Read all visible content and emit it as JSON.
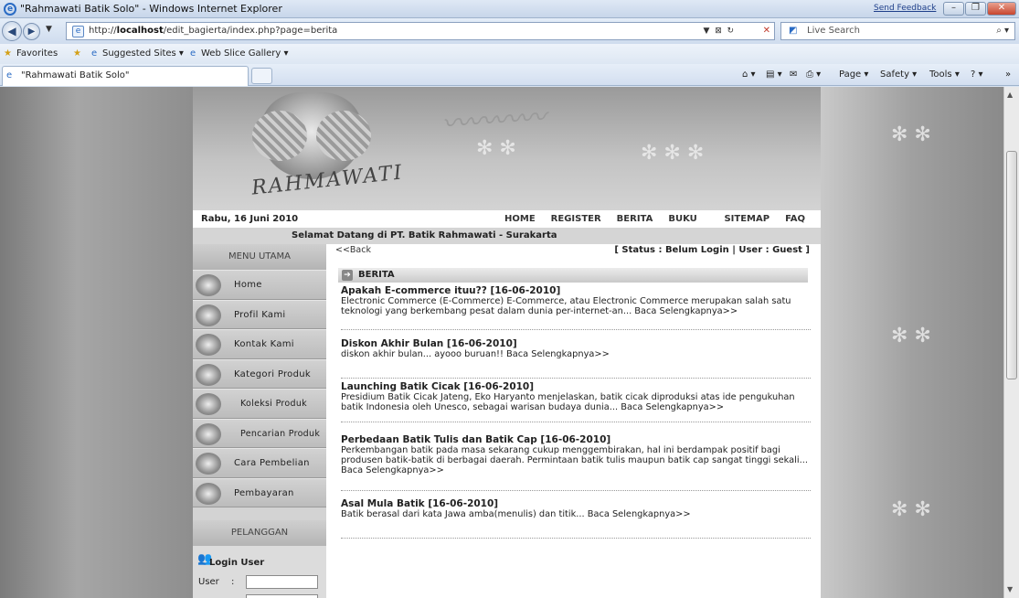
{
  "window": {
    "title": "\"Rahmawati Batik Solo\" - Windows Internet Explorer",
    "feedback": "Send Feedback"
  },
  "nav": {
    "url_prefix": "http://",
    "url_host": "localhost",
    "url_path": "/edit_bagierta/index.php?page=berita",
    "search_placeholder": "Live Search"
  },
  "favorites": {
    "favorites_label": "Favorites",
    "suggested_sites": "Suggested Sites ▾",
    "web_slice": "Web Slice Gallery ▾"
  },
  "tab": {
    "title": "\"Rahmawati Batik Solo\""
  },
  "command_bar": {
    "page": "Page ▾",
    "safety": "Safety ▾",
    "tools": "Tools ▾"
  },
  "site": {
    "brand": "RAHMAWATI",
    "date": "Rabu, 16 Juni 2010",
    "top_menu": [
      "HOME",
      "REGISTER",
      "BERITA",
      "BUKU TAMU",
      "SITEMAP",
      "FAQ"
    ],
    "welcome": "Selamat Datang di PT. Batik Rahmawati - Surakarta"
  },
  "sidebar": {
    "menu_title": "MENU UTAMA",
    "items": [
      {
        "label": "Home"
      },
      {
        "label": "Profil Kami"
      },
      {
        "label": "Kontak Kami"
      },
      {
        "label": "Kategori Produk"
      },
      {
        "label": "Koleksi Produk"
      },
      {
        "label": "Pencarian Produk"
      },
      {
        "label": "Cara Pembelian"
      },
      {
        "label": "Pembayaran"
      }
    ],
    "customer_title": "PELANGGAN",
    "login_title": "Login User",
    "user_label": "User",
    "colon": ":"
  },
  "content": {
    "back": "<<Back",
    "status": "[ Status : Belum Login | User : Guest ]",
    "section_title": "BERITA",
    "news": [
      {
        "title": "Apakah E-commerce ituu?? [16-06-2010]",
        "body": "Electronic Commerce (E-Commerce) E-Commerce, atau Electronic Commerce merupakan salah satu teknologi yang berkembang pesat dalam dunia per-internet-an... Baca Selengkapnya>>"
      },
      {
        "title": "Diskon Akhir Bulan [16-06-2010]",
        "body": "diskon akhir bulan... ayooo buruan!! Baca Selengkapnya>>"
      },
      {
        "title": "Launching Batik Cicak [16-06-2010]",
        "body": "Presidium Batik Cicak Jateng, Eko Haryanto menjelaskan, batik cicak diproduksi atas ide pengukuhan batik Indonesia oleh Unesco, sebagai warisan budaya dunia... Baca Selengkapnya>>"
      },
      {
        "title": "Perbedaan Batik Tulis dan Batik Cap [16-06-2010]",
        "body": "Perkembangan batik pada masa sekarang cukup menggembirakan, hal ini berdampak positif bagi produsen batik-batik di berbagai daerah. Permintaan batik tulis maupun batik cap sangat tinggi sekali... Baca Selengkapnya>>"
      },
      {
        "title": "Asal Mula Batik [16-06-2010]",
        "body": "Batik berasal dari kata Jawa amba(menulis) dan titik... Baca Selengkapnya>>"
      }
    ]
  },
  "colors": {
    "ie_blue": "#2a6bc4",
    "chrome_bg": "#d9e4f2",
    "page_gray": "#8f8f8f"
  }
}
